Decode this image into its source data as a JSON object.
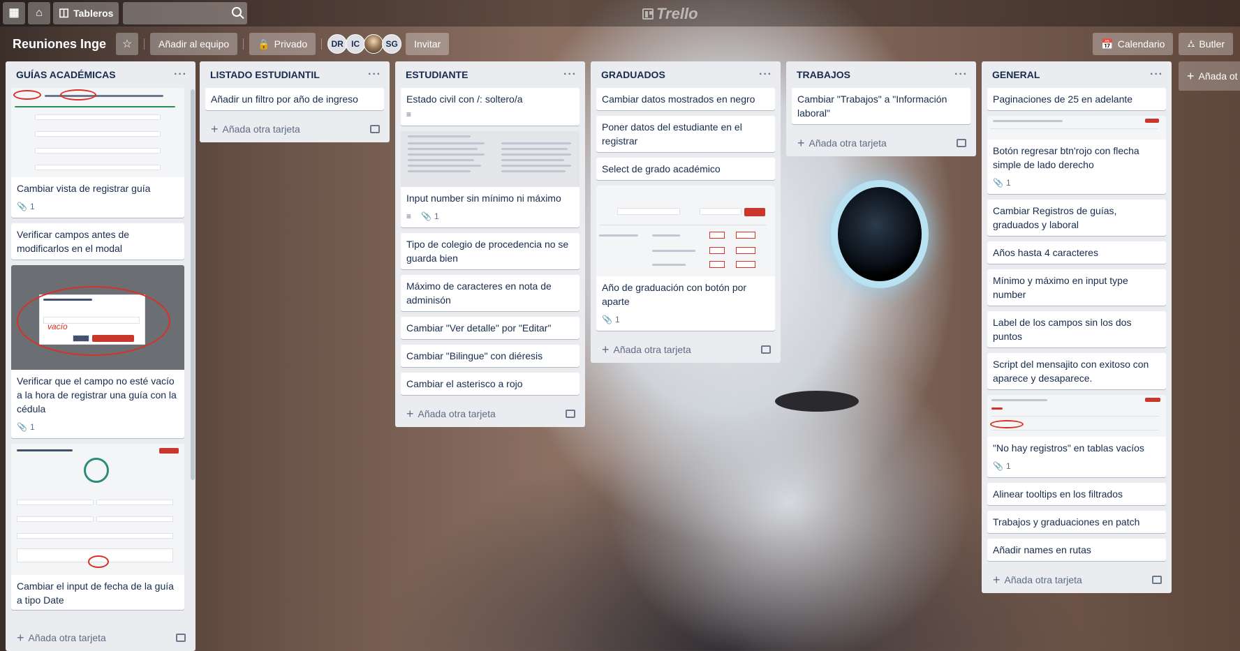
{
  "header": {
    "apps_icon": "grid-icon",
    "home_icon": "home-icon",
    "boards_label": "Tableros",
    "search_placeholder": "",
    "logo_text": "Trello"
  },
  "board": {
    "title": "Reuniones Inge",
    "team_button": "Añadir al equipo",
    "privacy_label": "Privado",
    "members": [
      "DR",
      "IC",
      "",
      "SG"
    ],
    "invite_label": "Invitar",
    "calendar_label": "Calendario",
    "butler_label": "Butler",
    "add_list_label": "Añada ot"
  },
  "lists": [
    {
      "title": "GUÍAS ACADÉMICAS",
      "cards": [
        {
          "text": "Cambiar vista de registrar guía",
          "attachments": "1"
        },
        {
          "text": "Verificar campos antes de modificarlos en el modal"
        },
        {
          "text": "Verificar que el campo no esté vacío a la hora de registrar una guía con la cédula",
          "attachments": "1",
          "cover_text": "vacío"
        },
        {
          "text": "Cambiar el input de fecha de la guía a tipo Date"
        }
      ],
      "add_label": "Añada otra tarjeta"
    },
    {
      "title": "LISTADO ESTUDIANTIL",
      "cards": [
        {
          "text": "Añadir un filtro por año de ingreso"
        }
      ],
      "add_label": "Añada otra tarjeta"
    },
    {
      "title": "ESTUDIANTE",
      "cards": [
        {
          "text": "Estado civil con /: soltero/a"
        },
        {
          "text": "Input number sin mínimo ni máximo",
          "attachments": "1"
        },
        {
          "text": "Tipo de colegio de procedencia no se guarda bien"
        },
        {
          "text": "Máximo de caracteres en nota de adminisón"
        },
        {
          "text": "Cambiar \"Ver detalle\" por \"Editar\""
        },
        {
          "text": "Cambiar \"Bilingue\" con diéresis"
        },
        {
          "text": "Cambiar el asterisco a rojo"
        }
      ],
      "add_label": "Añada otra tarjeta"
    },
    {
      "title": "GRADUADOS",
      "cards": [
        {
          "text": "Cambiar datos mostrados en negro"
        },
        {
          "text": "Poner datos del estudiante en el registrar"
        },
        {
          "text": "Select de grado académico"
        },
        {
          "text": "Año de graduación con botón por aparte",
          "attachments": "1"
        }
      ],
      "add_label": "Añada otra tarjeta"
    },
    {
      "title": "TRABAJOS",
      "cards": [
        {
          "text": "Cambiar \"Trabajos\" a \"Información laboral\""
        }
      ],
      "add_label": "Añada otra tarjeta"
    },
    {
      "title": "GENERAL",
      "cards": [
        {
          "text": "Paginaciones de 25 en adelante"
        },
        {
          "text": "Botón regresar btn'rojo con flecha simple de lado derecho",
          "attachments": "1"
        },
        {
          "text": "Cambiar Registros de guías, graduados y laboral"
        },
        {
          "text": "Años hasta 4 caracteres"
        },
        {
          "text": "Mínimo y máximo en input type number"
        },
        {
          "text": "Label de los campos sin los dos puntos"
        },
        {
          "text": "Script del mensajito con exitoso con aparece y desaparece."
        },
        {
          "text": "\"No hay registros\" en tablas vacíos",
          "attachments": "1"
        },
        {
          "text": "Alinear tooltips en los filtrados"
        },
        {
          "text": "Trabajos y graduaciones en patch"
        },
        {
          "text": "Añadir names en rutas"
        }
      ],
      "add_label": "Añada otra tarjeta"
    }
  ]
}
